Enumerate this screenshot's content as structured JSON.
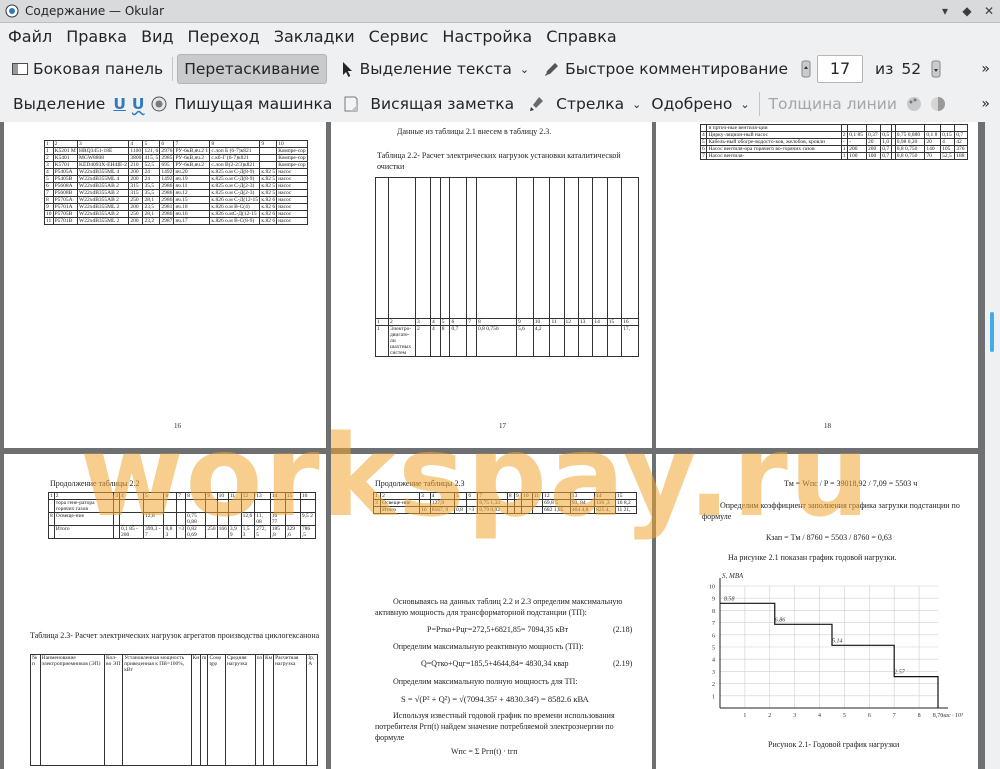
{
  "window": {
    "title": "Содержание — Okular"
  },
  "menu": [
    "Файл",
    "Правка",
    "Вид",
    "Переход",
    "Закладки",
    "Сервис",
    "Настройка",
    "Справка"
  ],
  "toolbar1": {
    "sidebar": "Боковая панель",
    "drag": "Перетаскивание",
    "select_text": "Выделение текста",
    "quick_comment": "Быстрое комментирование",
    "page_current": "17",
    "of": "из",
    "page_total": "52"
  },
  "toolbar2": {
    "select": "Выделение",
    "typewriter": "Пишущая машинка",
    "hanging_note": "Висящая заметка",
    "arrow": "Стрелка",
    "approved": "Одобрено",
    "line_width": "Толщина линии"
  },
  "pages": {
    "p16": {
      "number": "16",
      "col_nums": [
        "1",
        "2",
        "3",
        "4",
        "5",
        "6",
        "7",
        "8",
        "9",
        "10"
      ],
      "rows": [
        [
          "1",
          "K5201 M",
          "HRQ3451-18E",
          "1100",
          "121, 6",
          "2976",
          "РУ-6кВ,яч.2 1",
          "с.лоп Б (6-7)к821",
          "",
          "Компре-сор"
        ],
        [
          "2",
          "K5401",
          "MGW8808",
          "3800",
          "415, 5",
          "2985",
          "РУ-6кВ,яч.2",
          "с.кб-Г (6-7)к821",
          "",
          "Компре-сор"
        ],
        [
          "3",
          "K5701",
          "KED4093X-EH4IE-2",
          "210",
          "52,5",
          "695",
          "РУ-6кВ,яч.2",
          "с.лоп В(2-2/3)к821",
          "",
          "Компре-сор"
        ],
        [
          "4",
          "P5405A",
          "W22xdB355ML 4",
          "200",
          "24",
          "1492",
          "яч.20",
          "к.825 о.м С-Д(8-9)",
          "к.82 5",
          "насос"
        ],
        [
          "5",
          "P5405B",
          "W22xdB355ML 4",
          "200",
          "24",
          "1492",
          "яч.19",
          "к.825 о.м С-Д(8-9)",
          "к.82 5",
          "насос"
        ],
        [
          "6",
          "P5608A",
          "W22xdB355AB 2",
          "315",
          "35,5",
          "2986",
          "яч.11",
          "к.825 о.м С-Д(2-3)",
          "к.82 5",
          "насос"
        ],
        [
          "7",
          "P5608B",
          "W22xdB355AB 2",
          "315",
          "35,5",
          "2986",
          "яч.12",
          "к.825 о.м С-Д(2-3)",
          "к.82 5",
          "насос"
        ],
        [
          "8",
          "P5705A",
          "W22xdB355AB 2",
          "250",
          "28,1",
          "2986",
          "яч.15",
          "к.826 о.м С-Д(12-15",
          "к.82 6",
          "насос"
        ],
        [
          "9",
          "P5701A",
          "W22xdB355ML 2",
          "200",
          "23,5",
          "2981",
          "яч.18",
          "к.826 о.м В-С(4)",
          "к.82 6",
          "насос"
        ],
        [
          "10",
          "P5705B",
          "W22xdB355AB 2",
          "250",
          "28,1",
          "2986",
          "яч.16",
          "к.826 о.мС-Д(12-15",
          "к.82 6",
          "насос"
        ],
        [
          "11",
          "P5701B",
          "W22xdB355ML 2",
          "200",
          "23,2",
          "2987",
          "яч.17",
          "к.826 о.м В-С(8-9)",
          "к.82 6",
          "насос"
        ]
      ]
    },
    "p17": {
      "number": "17",
      "intro": "Данные из таблицы 2.1 внесем в таблицу 2.3.",
      "table_title": "Таблица 2.2- Расчет электрических нагрузок установки каталитической очистки",
      "rows": [
        [
          "1",
          "2",
          "3",
          "4",
          "5",
          "6",
          "7",
          "8",
          "9",
          "10",
          "11",
          "12",
          "13",
          "14",
          "15",
          "16"
        ],
        [
          "1",
          "Электро-двигате-ли шахтных систем",
          "2",
          "4",
          "8",
          "0,7",
          "",
          "0,8 0,750",
          "5,6",
          "4,2",
          "",
          "",
          "",
          "",
          "",
          "17,"
        ]
      ]
    },
    "p18": {
      "number": "18",
      "rows": [
        [
          "",
          "и прточ-ные вентиля-ции",
          "",
          "",
          "",
          "",
          "",
          "",
          "",
          "",
          ""
        ],
        [
          "4",
          "Цирку-ляцион-ный насос",
          "2",
          "0,1 85",
          "0,37",
          "0,5",
          "",
          "0,75 0,880",
          "0,1 8",
          "0,15",
          "0,7"
        ],
        [
          "5",
          "Кабель-ный обогре-водосто-ков, желобов, кровли",
          "-",
          "-",
          "20",
          "1,0",
          "",
          "0,98 0,20",
          "20",
          "4",
          "42"
        ],
        [
          "6",
          "Насос вентиля-ора горячего во-горячих газов",
          "1",
          "200",
          "200",
          "0,7",
          "",
          "0,8 0,750",
          "140",
          "105",
          "376"
        ],
        [
          "7",
          "Насос вентиля-",
          "1",
          "100",
          "100",
          "0,7",
          "",
          "0,8 0,750",
          "70",
          "52,5",
          "188"
        ]
      ]
    },
    "p19": {
      "caption": "Продолжение таблицы 2.2",
      "rows": [
        [
          "1",
          "2",
          "3",
          "4",
          "5",
          "6",
          "7",
          "8",
          "9",
          "10",
          "11",
          "12",
          "13",
          "14",
          "15",
          "16"
        ],
        [
          "",
          "тора гене-ратора горячих газов",
          "",
          "",
          "",
          "",
          "",
          "",
          "",
          "",
          "",
          "",
          "",
          "",
          "",
          ""
        ],
        [
          "8",
          "Освеще-ние",
          "",
          "",
          "12,6",
          "",
          "",
          "0,75 0,88",
          "",
          "",
          "",
          "12,6",
          "11, 08",
          "16 77",
          "",
          "9,5 2"
        ],
        [
          "",
          "Итого",
          "",
          "0,1 85 - 200",
          "399,3 - 7",
          "0,8 3",
          ">3",
          "0,82 0,69",
          "250",
          "166",
          "3,9 9",
          "1,5 3",
          "272, 5",
          "185 ,8",
          "329 ,6",
          "786 ,5"
        ]
      ],
      "table_title": "Таблица 2.3- Расчет электрических нагрузок агрегатов производства циклогексанона",
      "header_cols": [
        "№ п",
        "Наименование электроприемников (ЭП)",
        "Кол-во ЭП",
        "Установленная мощность приведенная к ПВ=100%, кВт",
        "Ки",
        "m",
        "Соsφ tgφ",
        "Средняя нагрузка",
        "nэ",
        "Км",
        "Расчетная нагрузка",
        "Iр, А"
      ]
    },
    "p20": {
      "caption": "Продолжение таблицы 2.3",
      "rows": [
        [
          "1",
          "2",
          "3",
          "4",
          "5",
          "6",
          "7",
          "8",
          "9",
          "10",
          "11",
          "12",
          "13",
          "14",
          "15"
        ],
        [
          "3",
          "Освеще-ние",
          "",
          "127,9",
          "",
          "",
          "0,75 1,33",
          "",
          "",
          "",
          "",
          "69,8 5",
          "93, 84",
          "116 ,3",
          "16 8,2"
        ],
        [
          "",
          "Итого",
          "16",
          "8567, 9",
          "0,8",
          ">3",
          "0,79 0,92",
          "",
          "",
          "",
          "",
          "682 1,85",
          "464 4,8",
          "825 4,",
          "11 21,"
        ]
      ],
      "para1": "Основываясь на данных таблиц 2.2 и 2.3 определим максимальную активную мощность для трансформаторной подстанции (ТП):",
      "eq1": "P=Pтко+Pцг=272,5+6821,85= 7094,35 кВт",
      "eq1_num": "(2.18)",
      "para2": "Определим максимальную реактивную мощность (ТП):",
      "eq2": "Q=Qтко+Qцг=185,5+4644,84= 4830,34 квар",
      "eq2_num": "(2.19)",
      "para3": "Определим максимальную полную мощность для ТП:",
      "eq3": "S = √(P² + Q²) = √(7094.35² + 4830.34²) = 8582.6 кВА",
      "para4": "Используя известный годовой график по времени использования потребителя Pгп(t) найдем значение потребляемой электроэнергии по формуле",
      "eq4": "Wпс = Σ Pгп(t) · tгп"
    },
    "p21": {
      "eq_tm": "Тм = Wпс / P = 39018,92 / 7,09 = 5503 ч",
      "para1": "Определим коэффициент заполнения графика загрузки подстанции по формуле",
      "eq_kzap": "Кзап = Тм / 8760 = 5503 / 8760 = 0,63",
      "para2": "На рисунке 2.1 показан график годовой нагрузки.",
      "caption": "Рисунок 2.1- Годовой график нагрузки"
    }
  },
  "watermark": "workspay.ru",
  "chart_data": {
    "type": "line",
    "step": true,
    "title": "",
    "ylabel": "S, МВА",
    "xlabel": "час · 10³",
    "xlim": [
      0,
      8.76
    ],
    "ylim": [
      0,
      10
    ],
    "x_ticks": [
      "1",
      "2",
      "3",
      "4",
      "5",
      "6",
      "7",
      "8",
      "8,76"
    ],
    "y_ticks": [
      "1",
      "2",
      "3",
      "4",
      "5",
      "6",
      "7",
      "8",
      "9",
      "10"
    ],
    "grid": true,
    "segments": [
      {
        "x0": 0,
        "x1": 2.2,
        "y": 8.58,
        "label": "8.58"
      },
      {
        "x0": 2.2,
        "x1": 4.5,
        "y": 6.86,
        "label": "6.86"
      },
      {
        "x0": 4.5,
        "x1": 7.0,
        "y": 5.14,
        "label": "5.14"
      },
      {
        "x0": 7.0,
        "x1": 8.76,
        "y": 2.57,
        "label": "2.57"
      }
    ]
  }
}
